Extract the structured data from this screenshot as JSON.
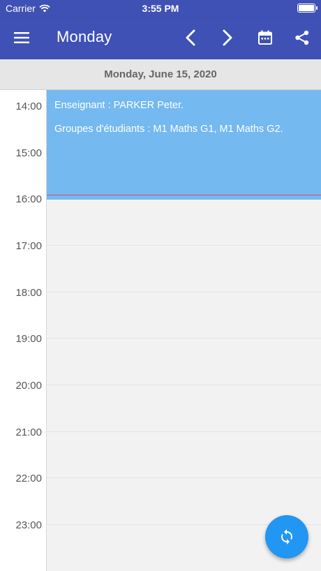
{
  "status_bar": {
    "carrier": "Carrier",
    "time": "3:55 PM",
    "wifi_icon": "wifi-icon",
    "battery_icon": "battery-icon"
  },
  "app_bar": {
    "title": "Monday",
    "menu_icon": "menu-icon",
    "prev_icon": "chevron-left-icon",
    "next_icon": "chevron-right-icon",
    "calendar_icon": "calendar-icon",
    "share_icon": "share-icon"
  },
  "date_header": "Monday, June 15, 2020",
  "hours": [
    "14:00",
    "15:00",
    "16:00",
    "17:00",
    "18:00",
    "19:00",
    "20:00",
    "21:00",
    "22:00",
    "23:00"
  ],
  "event": {
    "teacher": "Enseignant : PARKER Peter.",
    "groups": "Groupes d'étudiants : M1 Maths G1, M1 Maths G2."
  },
  "fab": {
    "icon": "refresh-icon"
  },
  "colors": {
    "app_bar": "#3f51b5",
    "event": "#74b9f0",
    "fab": "#2196f3",
    "now_line": "#e0457b"
  }
}
